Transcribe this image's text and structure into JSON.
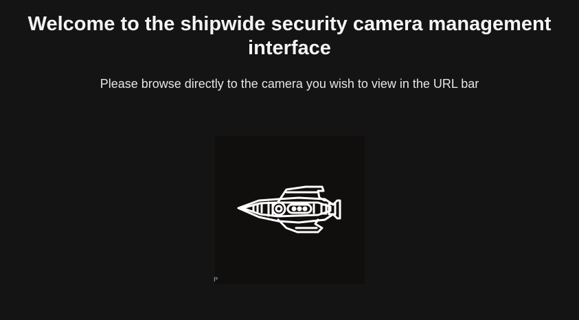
{
  "page": {
    "title": "Welcome to the shipwide security camera management interface",
    "subtitle": "Please browse directly to the camera you wish to view in the URL bar"
  },
  "logo": {
    "icon": "spaceship-icon",
    "background": "#110f0e",
    "stroke": "#ffffff"
  },
  "cursor": {
    "icon": "text-cursor-icon",
    "glyph": "Iᵇ"
  }
}
